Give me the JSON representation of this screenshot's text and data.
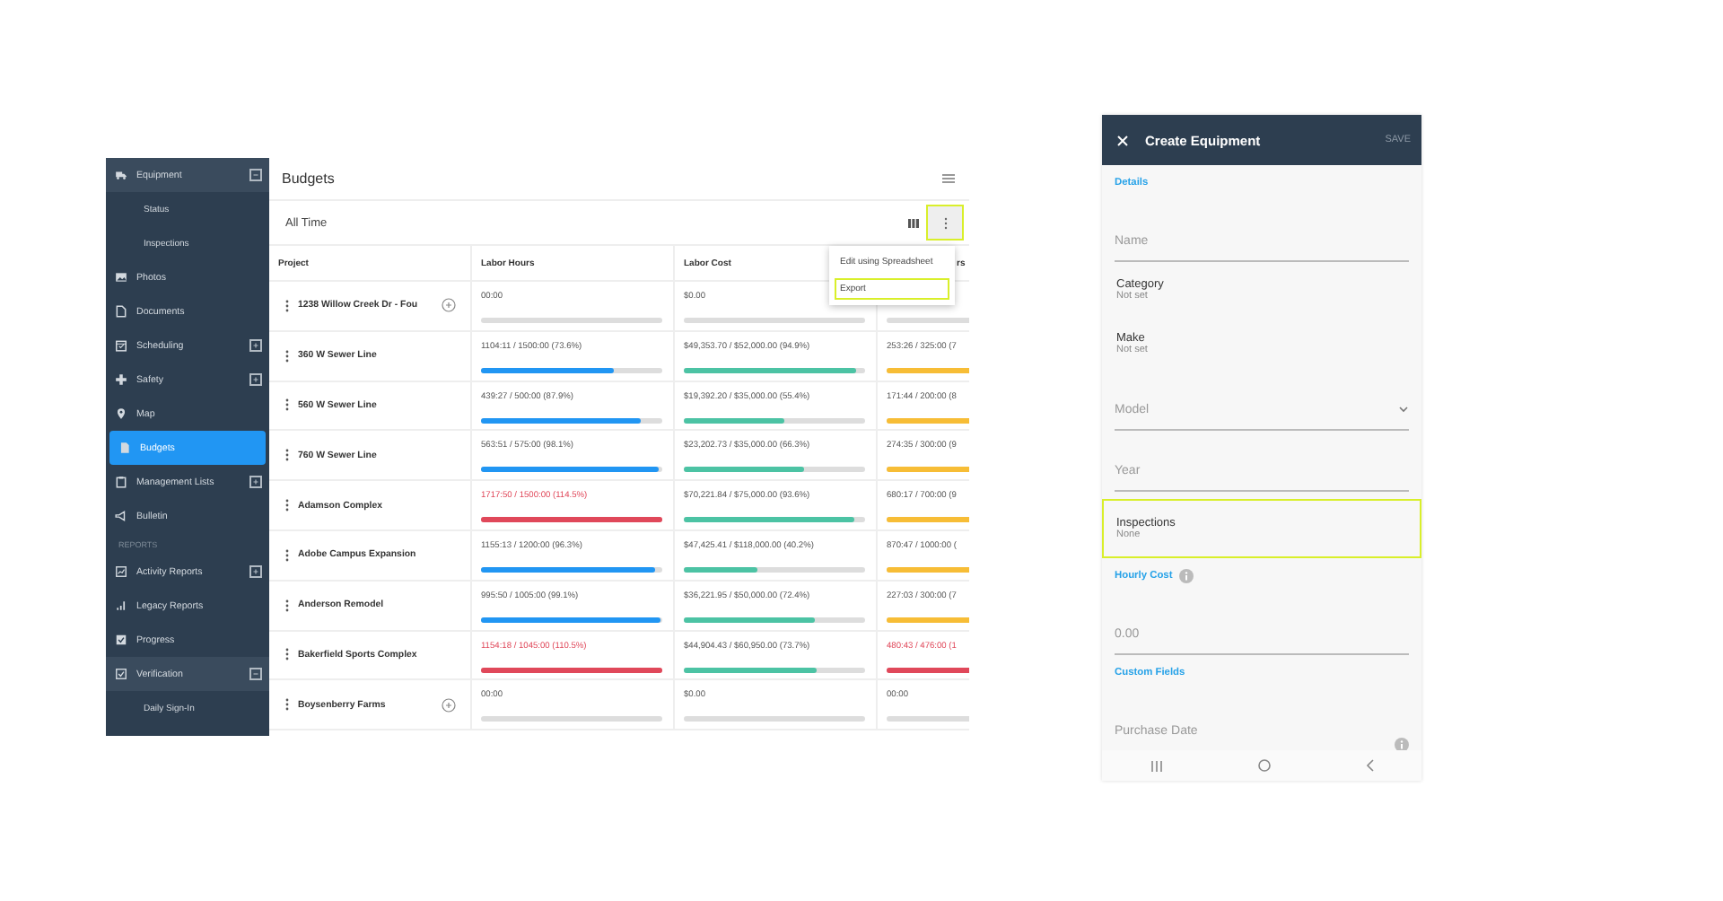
{
  "sidebar": {
    "items": [
      {
        "kind": "group",
        "label": "Equipment",
        "selected": false,
        "expanded": true,
        "children": [
          {
            "label": "Status",
            "selected": false
          },
          {
            "label": "Inspections",
            "selected": false
          }
        ]
      },
      {
        "kind": "link",
        "label": "Photos",
        "selected": false
      },
      {
        "kind": "link",
        "label": "Documents",
        "selected": false
      },
      {
        "kind": "group",
        "label": "Scheduling",
        "selected": false,
        "expanded": false
      },
      {
        "kind": "group",
        "label": "Safety",
        "selected": false,
        "expanded": false
      },
      {
        "kind": "link",
        "label": "Map",
        "selected": false
      },
      {
        "kind": "link",
        "label": "Budgets",
        "selected": true
      },
      {
        "kind": "group",
        "label": "Management Lists",
        "selected": false,
        "expanded": false
      },
      {
        "kind": "link",
        "label": "Bulletin",
        "selected": false
      },
      {
        "kind": "header",
        "label": "REPORTS"
      },
      {
        "kind": "group",
        "label": "Activity Reports",
        "selected": false,
        "expanded": false
      },
      {
        "kind": "link",
        "label": "Legacy Reports",
        "selected": false
      },
      {
        "kind": "link",
        "label": "Progress",
        "selected": false
      },
      {
        "kind": "group",
        "label": "Verification",
        "selected": false,
        "expanded": true,
        "children": [
          {
            "label": "Daily Sign-In",
            "selected": false
          }
        ]
      }
    ]
  },
  "budgets": {
    "title": "Budgets",
    "filter": "All Time",
    "more_button": {
      "highlighted": true
    },
    "menu": [
      {
        "label": "Edit using Spreadsheet",
        "highlighted": false
      },
      {
        "label": "Export",
        "highlighted": true
      }
    ],
    "columns": [
      "Project",
      "Labor Hours",
      "Labor Cost",
      "rs"
    ],
    "rows": [
      {
        "cells": [
          {
            "kind": "project",
            "text": "1238 Willow Creek Dr - Fou",
            "add": true
          },
          {
            "kind": "bar",
            "text": "00:00",
            "level": 0,
            "over": false
          },
          {
            "kind": "bar",
            "text": "$0.00",
            "level": 0,
            "over": false
          },
          {
            "kind": "bar",
            "level": 0,
            "over": false
          }
        ]
      },
      {
        "cells": [
          {
            "kind": "project",
            "text": "360 W Sewer Line",
            "add": false
          },
          {
            "kind": "bar",
            "text": "1104:11 / 1500:00 (73.6%)",
            "level": 0.736,
            "over": false
          },
          {
            "kind": "bar",
            "text": "$49,353.70 / $52,000.00 (94.9%)",
            "level": 0.949,
            "over": false
          },
          {
            "kind": "bar",
            "text": "253:26 / 325:00 (7",
            "level": 0.78,
            "over": false
          }
        ]
      },
      {
        "cells": [
          {
            "kind": "project",
            "text": "560 W Sewer Line",
            "add": false
          },
          {
            "kind": "bar",
            "text": "439:27 / 500:00 (87.9%)",
            "level": 0.879,
            "over": false
          },
          {
            "kind": "bar",
            "text": "$19,392.20 / $35,000.00 (55.4%)",
            "level": 0.554,
            "over": false
          },
          {
            "kind": "bar",
            "text": "171:44 / 200:00 (8",
            "level": 0.86,
            "over": false
          }
        ]
      },
      {
        "cells": [
          {
            "kind": "project",
            "text": "760 W Sewer Line",
            "add": false
          },
          {
            "kind": "bar",
            "text": "563:51 / 575:00 (98.1%)",
            "level": 0.981,
            "over": false
          },
          {
            "kind": "bar",
            "text": "$23,202.73 / $35,000.00 (66.3%)",
            "level": 0.663,
            "over": false
          },
          {
            "kind": "bar",
            "text": "274:35 / 300:00 (9",
            "level": 0.91,
            "over": false
          }
        ]
      },
      {
        "cells": [
          {
            "kind": "project",
            "text": "Adamson Complex",
            "add": false
          },
          {
            "kind": "bar",
            "text": "1717:50 / 1500:00 (114.5%)",
            "level": 1,
            "over": true
          },
          {
            "kind": "bar",
            "text": "$70,221.84 / $75,000.00 (93.6%)",
            "level": 0.936,
            "over": false
          },
          {
            "kind": "bar",
            "text": "680:17 / 700:00 (9",
            "level": 0.97,
            "over": false
          }
        ]
      },
      {
        "cells": [
          {
            "kind": "project",
            "text": "Adobe Campus Expansion",
            "add": false
          },
          {
            "kind": "bar",
            "text": "1155:13 / 1200:00 (96.3%)",
            "level": 0.963,
            "over": false
          },
          {
            "kind": "bar",
            "text": "$47,425.41 / $118,000.00 (40.2%)",
            "level": 0.402,
            "over": false
          },
          {
            "kind": "bar",
            "text": "870:47 / 1000:00 (",
            "level": 0.87,
            "over": false
          }
        ]
      },
      {
        "cells": [
          {
            "kind": "project",
            "text": "Anderson Remodel",
            "add": false
          },
          {
            "kind": "bar",
            "text": "995:50 / 1005:00 (99.1%)",
            "level": 0.991,
            "over": false
          },
          {
            "kind": "bar",
            "text": "$36,221.95 / $50,000.00 (72.4%)",
            "level": 0.724,
            "over": false
          },
          {
            "kind": "bar",
            "text": "227:03 / 300:00 (7",
            "level": 0.76,
            "over": false
          }
        ]
      },
      {
        "cells": [
          {
            "kind": "project",
            "text": "Bakerfield Sports Complex",
            "add": false
          },
          {
            "kind": "bar",
            "text": "1154:18 / 1045:00 (110.5%)",
            "level": 1,
            "over": true
          },
          {
            "kind": "bar",
            "text": "$44,904.43 / $60,950.00 (73.7%)",
            "level": 0.737,
            "over": false
          },
          {
            "kind": "bar",
            "text": "480:43 / 476:00 (1",
            "level": 1,
            "over": true
          }
        ]
      },
      {
        "cells": [
          {
            "kind": "project",
            "text": "Boysenberry Farms",
            "add": true
          },
          {
            "kind": "bar",
            "text": "00:00",
            "level": 0,
            "over": false
          },
          {
            "kind": "bar",
            "text": "$0.00",
            "level": 0,
            "over": false
          },
          {
            "kind": "bar",
            "text": "00:00",
            "level": 0,
            "over": false
          }
        ]
      }
    ]
  },
  "phone": {
    "title": "Create Equipment",
    "action": "SAVE",
    "fields": [
      {
        "kind": "section",
        "label": "Details"
      },
      {
        "kind": "input",
        "placeholder": "Name"
      },
      {
        "kind": "select",
        "label": "Category",
        "value": "Not set",
        "highlighted": false
      },
      {
        "kind": "select",
        "label": "Make",
        "value": "Not set",
        "highlighted": false
      },
      {
        "kind": "dropdown",
        "placeholder": "Model"
      },
      {
        "kind": "input",
        "placeholder": "Year"
      },
      {
        "kind": "select",
        "label": "Inspections",
        "value": "None",
        "highlighted": true
      },
      {
        "kind": "section",
        "label": "Hourly Cost",
        "info": true
      },
      {
        "kind": "input",
        "placeholder": "0.00"
      },
      {
        "kind": "section",
        "label": "Custom Fields"
      },
      {
        "kind": "input",
        "placeholder": "Purchase Date",
        "info": true
      }
    ]
  }
}
